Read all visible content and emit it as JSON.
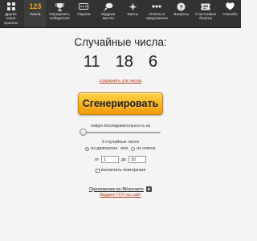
{
  "nav": [
    {
      "label": "Другие наши\nпроекты",
      "icon": "grid-icon",
      "active": false
    },
    {
      "label": "Числа",
      "number": "123",
      "icon": "numbers-icon",
      "active": true
    },
    {
      "label": "Определить\nпобедителя",
      "icon": "trophy-icon",
      "active": false
    },
    {
      "label": "Пароли",
      "icon": "password-icon",
      "active": false
    },
    {
      "label": "Мудрые\nмысли",
      "icon": "thought-bubble-icon",
      "active": false
    },
    {
      "label": "Факты",
      "icon": "facts-icon",
      "active": false
    },
    {
      "label": "Ответы и\nпредсказания",
      "icon": "dots-icon",
      "active": false
    },
    {
      "label": "Вопросы",
      "icon": "question-icon",
      "active": false
    },
    {
      "label": "Счастливые\nбилеты",
      "icon": "ticket-icon",
      "active": false
    },
    {
      "label": "Спасибо",
      "icon": "heart-icon",
      "active": false
    }
  ],
  "main": {
    "title": "Случайные числа:",
    "numbers": [
      "11",
      "18",
      "6"
    ],
    "save_link": "сохранить эти числа",
    "generate_button": "Сгенерировать",
    "new_sequence_label": "новую последовательность из",
    "count_label": "3 случайных чисел",
    "mode_range": "из диапазона",
    "mode_or": "или",
    "mode_list": "из списка",
    "from_label": "от",
    "from_value": "1",
    "to_label": "до",
    "to_value": "30",
    "no_repeat_label": "исключить повторения",
    "vk_link": "Приложение во ВКонтакте",
    "vk_badge": "В",
    "widget_link": "Виджет ГСЧ на сайт"
  },
  "colors": {
    "nav_background": "#323232",
    "accent_number": "#f2a21a",
    "button_yellow": "#f7b21b",
    "link_red": "#b33a1a"
  }
}
